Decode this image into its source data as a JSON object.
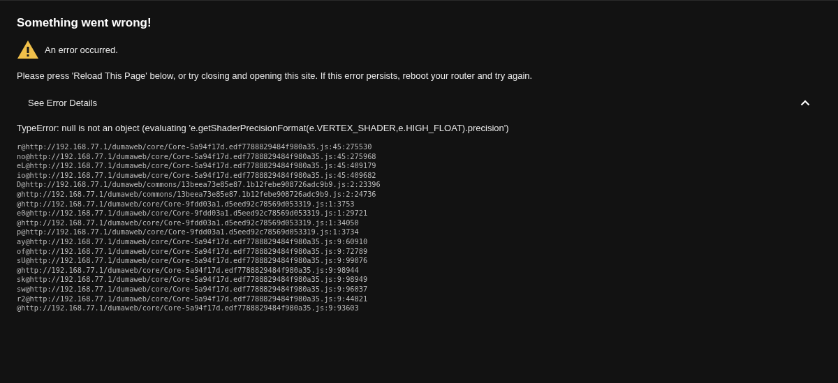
{
  "title": "Something went wrong!",
  "alert": {
    "text": "An error occurred."
  },
  "message": "Please press 'Reload This Page' below, or try closing and opening this site. If this error persists, reboot your router and try again.",
  "details": {
    "label": "See Error Details",
    "expanded": true,
    "error": "TypeError: null is not an object (evaluating 'e.getShaderPrecisionFormat(e.VERTEX_SHADER,e.HIGH_FLOAT).precision')",
    "stack": [
      "r@http://192.168.77.1/dumaweb/core/Core-5a94f17d.edf7788829484f980a35.js:45:275530",
      "no@http://192.168.77.1/dumaweb/core/Core-5a94f17d.edf7788829484f980a35.js:45:275968",
      "eL@http://192.168.77.1/dumaweb/core/Core-5a94f17d.edf7788829484f980a35.js:45:409179",
      "io@http://192.168.77.1/dumaweb/core/Core-5a94f17d.edf7788829484f980a35.js:45:409682",
      "D@http://192.168.77.1/dumaweb/commons/13beea73e85e87.1b12febe908726adc9b9.js:2:23396",
      "@http://192.168.77.1/dumaweb/commons/13beea73e85e87.1b12febe908726adc9b9.js:2:24736",
      "@http://192.168.77.1/dumaweb/core/Core-9fdd03a1.d5eed92c78569d053319.js:1:3753",
      "e0@http://192.168.77.1/dumaweb/core/Core-9fdd03a1.d5eed92c78569d053319.js:1:29721",
      "@http://192.168.77.1/dumaweb/core/Core-9fdd03a1.d5eed92c78569d053319.js:1:34050",
      "p@http://192.168.77.1/dumaweb/core/Core-9fdd03a1.d5eed92c78569d053319.js:1:3734",
      "ay@http://192.168.77.1/dumaweb/core/Core-5a94f17d.edf7788829484f980a35.js:9:60910",
      "of@http://192.168.77.1/dumaweb/core/Core-5a94f17d.edf7788829484f980a35.js:9:72789",
      "sU@http://192.168.77.1/dumaweb/core/Core-5a94f17d.edf7788829484f980a35.js:9:99076",
      "@http://192.168.77.1/dumaweb/core/Core-5a94f17d.edf7788829484f980a35.js:9:98944",
      "sk@http://192.168.77.1/dumaweb/core/Core-5a94f17d.edf7788829484f980a35.js:9:98949",
      "sw@http://192.168.77.1/dumaweb/core/Core-5a94f17d.edf7788829484f980a35.js:9:96037",
      "r2@http://192.168.77.1/dumaweb/core/Core-5a94f17d.edf7788829484f980a35.js:9:44821",
      "@http://192.168.77.1/dumaweb/core/Core-5a94f17d.edf7788829484f980a35.js:9:93603"
    ]
  }
}
